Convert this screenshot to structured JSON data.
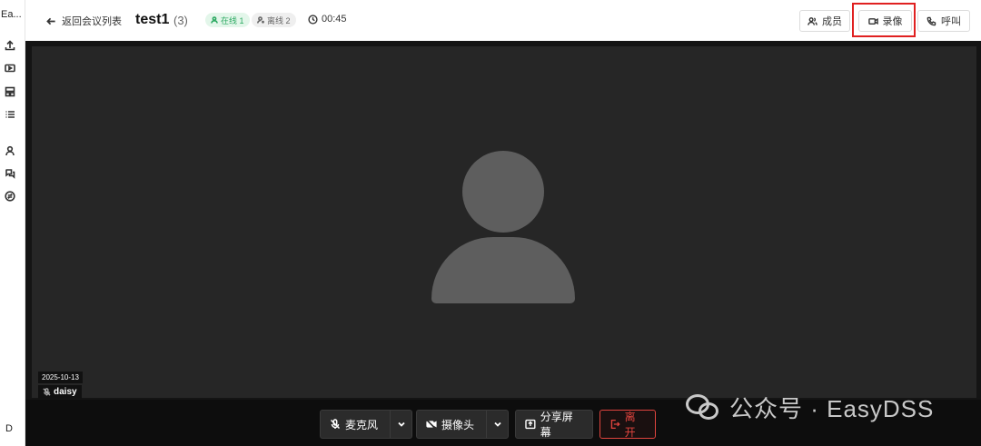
{
  "sidebar": {
    "brand": "Ea...",
    "user_initial": "D",
    "icons": [
      "upload-icon",
      "video-icon",
      "layout-icon",
      "list-icon",
      "user-icon",
      "chat-icon",
      "swap-icon"
    ]
  },
  "header": {
    "back_label": "返回会议列表",
    "title": "test1",
    "count": "(3)",
    "online_label": "在线 1",
    "offline_label": "离线 2",
    "timer": "00:45",
    "members_label": "成员",
    "record_label": "录像",
    "call_label": "呼叫"
  },
  "video": {
    "date": "2025-10-13",
    "participant": "daisy"
  },
  "controls": {
    "mic_label": "麦克风",
    "camera_label": "摄像头",
    "share_label": "分享屏幕",
    "leave_label": "离开"
  },
  "watermark": {
    "text": "公众号 · EasyDSS"
  },
  "colors": {
    "online": "#2aa860",
    "leave": "#e0443e",
    "highlight": "#e02020",
    "stage": "#262626"
  }
}
